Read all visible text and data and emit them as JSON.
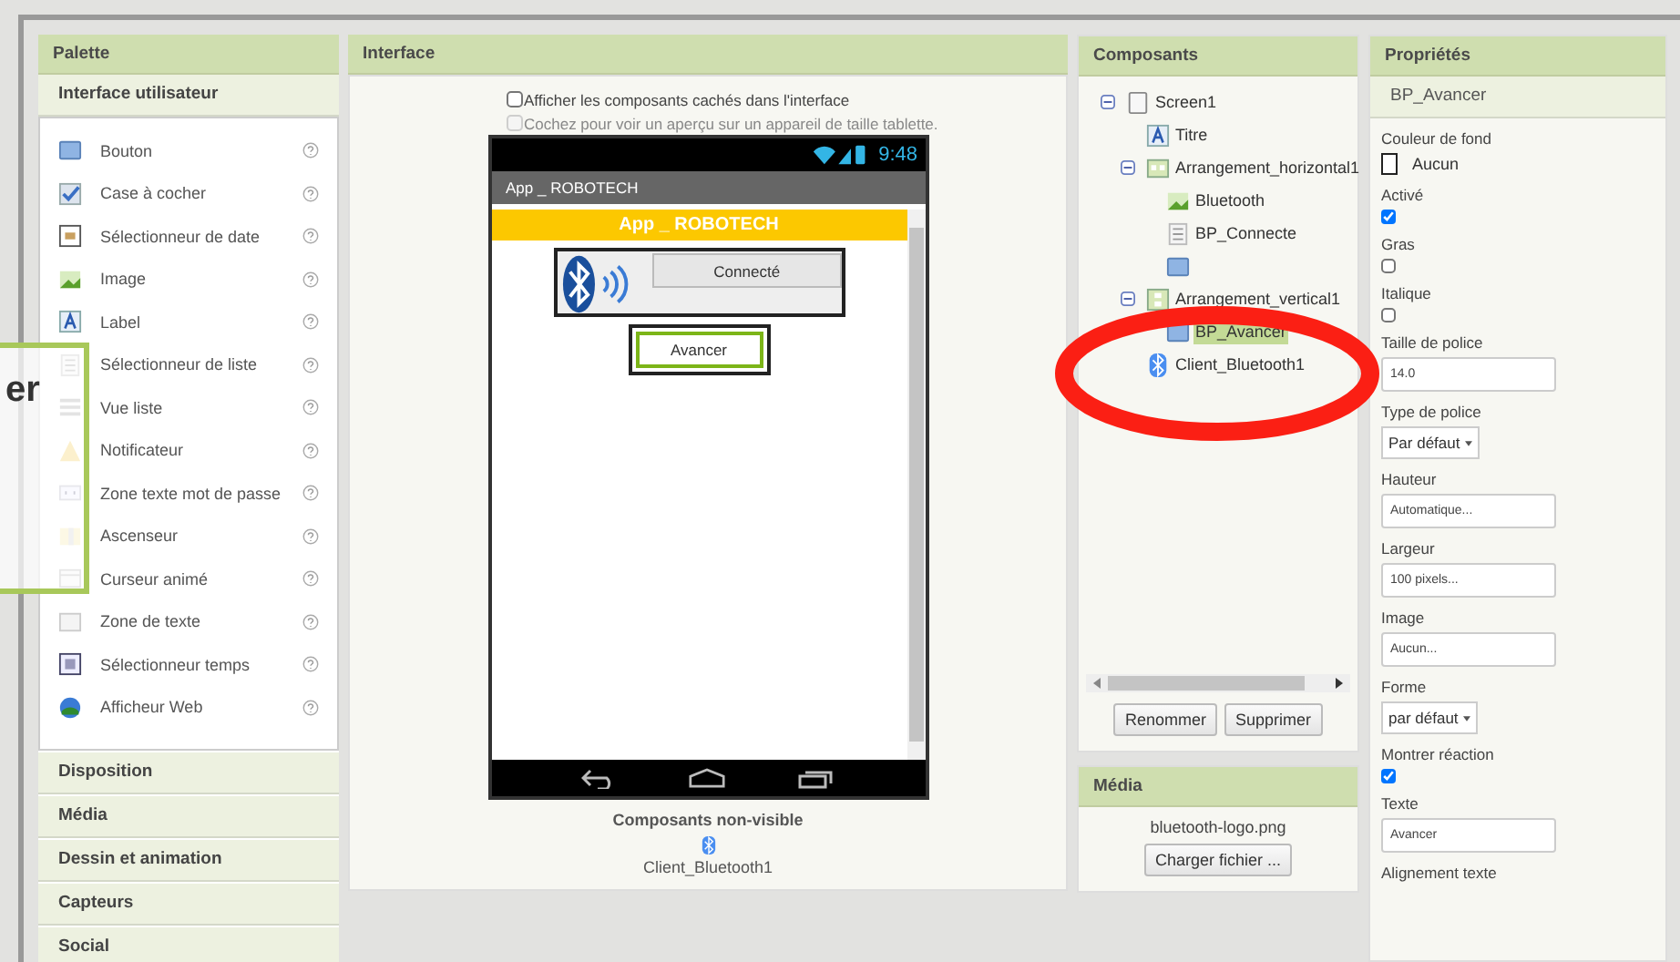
{
  "palette": {
    "title": "Palette",
    "open_section": "Interface utilisateur",
    "items": [
      {
        "label": "Bouton",
        "kind": "button"
      },
      {
        "label": "Case à cocher",
        "kind": "checkbox"
      },
      {
        "label": "Sélectionneur de date",
        "kind": "date"
      },
      {
        "label": "Image",
        "kind": "image"
      },
      {
        "label": "Label",
        "kind": "label"
      },
      {
        "label": "Sélectionneur de liste",
        "kind": "list"
      },
      {
        "label": "Vue liste",
        "kind": "lines"
      },
      {
        "label": "Notificateur",
        "kind": "warning"
      },
      {
        "label": "Zone texte mot de passe",
        "kind": "password"
      },
      {
        "label": "Ascenseur",
        "kind": "slider"
      },
      {
        "label": "Curseur animé",
        "kind": "spinner"
      },
      {
        "label": "Zone de texte",
        "kind": "textbox"
      },
      {
        "label": "Sélectionneur temps",
        "kind": "time"
      },
      {
        "label": "Afficheur Web",
        "kind": "web"
      }
    ],
    "sections": [
      "Disposition",
      "Média",
      "Dessin et animation",
      "Capteurs",
      "Social"
    ]
  },
  "interface": {
    "title": "Interface",
    "options": [
      {
        "label": "Afficher les composants cachés dans l'interface",
        "checked": false,
        "disabled": false
      },
      {
        "label": "Cochez pour voir un aperçu sur un appareil de taille tablette.",
        "checked": false,
        "disabled": true
      }
    ],
    "phone": {
      "time": "9:48",
      "app_title": "App _ ROBOTECH",
      "title_label": "App _ ROBOTECH",
      "connect_button": "Connecté",
      "forward_button": {
        "label": "Avancer",
        "selected": true
      }
    },
    "nonvisible_title": "Composants non-visible",
    "nonvisible": [
      {
        "name": "Client_Bluetooth1"
      }
    ]
  },
  "components": {
    "title": "Composants",
    "tree": [
      {
        "name": "Screen1",
        "kind": "screen",
        "selected": false,
        "expanded": true,
        "children": [
          {
            "name": "Titre",
            "kind": "label",
            "selected": false
          },
          {
            "name": "Arrangement_horizontal1",
            "kind": "harr",
            "selected": false,
            "expanded": true,
            "children": [
              {
                "name": "Bluetooth",
                "kind": "image",
                "selected": false
              },
              {
                "name": "BP_Connecte",
                "kind": "list",
                "selected": false
              },
              {
                "kind": "button",
                "selected": false
              }
            ]
          },
          {
            "name": "Arrangement_vertical1",
            "kind": "varr",
            "selected": false,
            "expanded": true,
            "children": [
              {
                "name": "BP_Avancer",
                "kind": "button",
                "selected": true
              }
            ]
          },
          {
            "name": "Client_Bluetooth1",
            "kind": "bluetooth",
            "selected": false
          }
        ]
      }
    ],
    "buttons": [
      "Renommer",
      "Supprimer"
    ]
  },
  "media": {
    "title": "Média",
    "files": [
      "bluetooth-logo.png"
    ],
    "upload_button": "Charger fichier ..."
  },
  "properties": {
    "title": "Propriétés",
    "component": "BP_Avancer",
    "items": [
      {
        "kind": "color",
        "label": "Couleur de fond",
        "value": "Aucun"
      },
      {
        "kind": "checkbox",
        "label": "Activé",
        "checked": true
      },
      {
        "kind": "checkbox",
        "label": "Gras",
        "checked": false
      },
      {
        "kind": "checkbox",
        "label": "Italique",
        "checked": false
      },
      {
        "kind": "text",
        "label": "Taille de police",
        "value": "14.0"
      },
      {
        "kind": "dropdown",
        "label": "Type de police",
        "value": "Par défaut"
      },
      {
        "kind": "text",
        "label": "Hauteur",
        "value": "Automatique..."
      },
      {
        "kind": "text",
        "label": "Largeur",
        "value": "100 pixels..."
      },
      {
        "kind": "text",
        "label": "Image",
        "value": "Aucun..."
      },
      {
        "kind": "dropdown",
        "label": "Forme",
        "value": "par défaut"
      },
      {
        "kind": "checkbox",
        "label": "Montrer réaction",
        "checked": true
      },
      {
        "kind": "text",
        "label": "Texte",
        "value": "Avancer"
      },
      {
        "kind": "heading",
        "label": "Alignement texte"
      }
    ]
  },
  "overlay": {
    "text": "er"
  }
}
